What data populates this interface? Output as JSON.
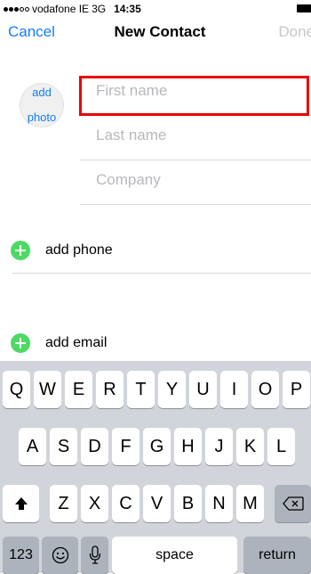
{
  "status_bar": {
    "carrier": "vodafone IE",
    "network": "3G",
    "time": "14:35",
    "signal_dots_filled": 3,
    "signal_dots_total": 5
  },
  "nav": {
    "cancel_label": "Cancel",
    "title": "New Contact",
    "done_label": "Done"
  },
  "photo": {
    "line1": "add",
    "line2": "photo"
  },
  "fields": {
    "first_name_placeholder": "First name",
    "last_name_placeholder": "Last name",
    "company_placeholder": "Company"
  },
  "actions": {
    "add_phone": "add phone",
    "add_email": "add email"
  },
  "keyboard": {
    "row1": [
      "Q",
      "W",
      "E",
      "R",
      "T",
      "Y",
      "U",
      "I",
      "O",
      "P"
    ],
    "row2": [
      "A",
      "S",
      "D",
      "F",
      "G",
      "H",
      "J",
      "K",
      "L"
    ],
    "row3": [
      "Z",
      "X",
      "C",
      "V",
      "B",
      "N",
      "M"
    ],
    "numbers_label": "123",
    "space_label": "space",
    "return_label": "return",
    "shift_icon": "shift-arrow-icon",
    "delete_icon": "backspace-icon",
    "emoji_icon": "emoji-icon",
    "mic_icon": "microphone-icon"
  },
  "colors": {
    "accent": "#157efb",
    "highlight": "#ea0000",
    "plus_green": "#4cd964",
    "keyboard_bg": "#d1d5db"
  }
}
